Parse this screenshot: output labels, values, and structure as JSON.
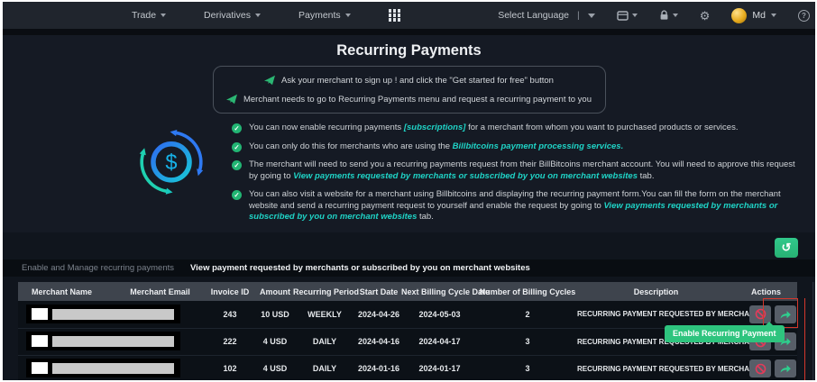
{
  "navbar": {
    "items": [
      {
        "label": "Trade"
      },
      {
        "label": "Derivatives"
      },
      {
        "label": "Payments"
      }
    ],
    "language_label": "Select Language",
    "language_separator": "|",
    "user_label": "Md"
  },
  "page": {
    "title": "Recurring Payments"
  },
  "info_box": {
    "lines": [
      "Ask your merchant to sign up ! and click the \"Get started for free\" button",
      "Merchant needs to go to Recurring Payments menu and request a recurring payment to you"
    ]
  },
  "bullets": [
    {
      "pre": "You can now enable recurring payments ",
      "link": "[subscriptions]",
      "post": " for a merchant from whom you want to purchased products or services."
    },
    {
      "pre": "You can only do this for merchants who are using the ",
      "link": "Billbitcoins payment processing services.",
      "post": ""
    },
    {
      "pre": "The merchant will need to send you a recurring payments request from their BillBitcoins merchant account. You will need to approve this request by going to ",
      "link": "View payments requested by merchants or subscribed by you on merchant websites",
      "post": " tab."
    },
    {
      "pre": "You can also visit a website for a merchant using Billbitcoins and displaying the recurring payment form.You can fill the form on the merchant website and send a recurring payment request to yourself and enable the request by going to ",
      "link": "View payments requested by merchants or subscribed by you on merchant websites",
      "post": " tab."
    }
  ],
  "tabs": [
    {
      "label": "Enable and Manage recurring payments",
      "active": false
    },
    {
      "label": "View payment requested by merchants or subscribed by you on merchant websites",
      "active": true
    }
  ],
  "table": {
    "headers": [
      "Merchant Name",
      "Merchant Email",
      "Invoice ID",
      "Amount",
      "Recurring Period",
      "Start Date",
      "Next Billing Cycle Date",
      "Number of Billing Cycles",
      "Description",
      "Actions"
    ],
    "rows": [
      {
        "invoice_id": "243",
        "amount": "10 USD",
        "recurring_period": "WEEKLY",
        "start_date": "2024-04-26",
        "next_billing_date": "2024-05-03",
        "billing_cycles": "2",
        "description": "RECURRING PAYMENT REQUESTED BY MERCHANT"
      },
      {
        "invoice_id": "222",
        "amount": "4 USD",
        "recurring_period": "DAILY",
        "start_date": "2024-04-16",
        "next_billing_date": "2024-04-17",
        "billing_cycles": "3",
        "description": "RECURRING PAYMENT REQUESTED BY MERCHANT"
      },
      {
        "invoice_id": "102",
        "amount": "4 USD",
        "recurring_period": "DAILY",
        "start_date": "2024-01-16",
        "next_billing_date": "2024-01-17",
        "billing_cycles": "3",
        "description": "RECURRING PAYMENT REQUESTED BY MERCHANT"
      }
    ]
  },
  "tooltip": {
    "label": "Enable Recurring Payment"
  },
  "icons": {
    "gear": "⚙",
    "history": "↺",
    "check": "✓",
    "question": "?",
    "dollar": "$"
  },
  "colors": {
    "accent_green": "#2ec47e",
    "link_cyan": "#1fd3c6",
    "danger_red": "#d5372c",
    "table_header_bg": "#3e444d",
    "navbar_bg": "#20252d",
    "content_bg": "#151a24"
  }
}
